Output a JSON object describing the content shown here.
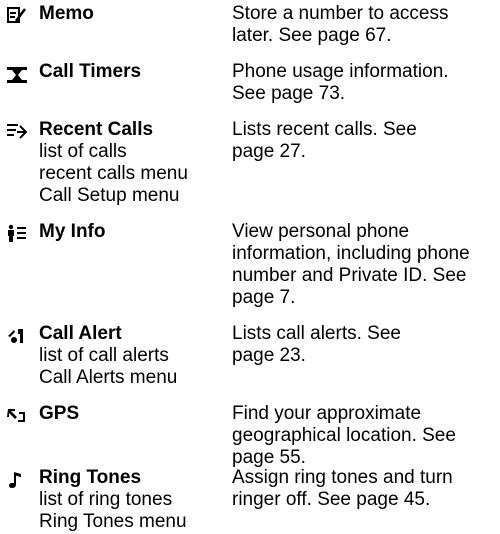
{
  "items": [
    {
      "icon": "memo-icon",
      "title": "Memo",
      "subs": [],
      "desc": [
        "Store a number to access",
        "later. See page 67."
      ]
    },
    {
      "icon": "call-timers-icon",
      "title": "Call Timers",
      "subs": [],
      "desc": [
        "Phone usage information.",
        "See page 73."
      ]
    },
    {
      "icon": "recent-calls-icon",
      "title": "Recent Calls",
      "subs": [
        "list of calls",
        "recent calls menu",
        "Call Setup menu"
      ],
      "desc": [
        "Lists recent calls. See",
        "page 27."
      ]
    },
    {
      "icon": "my-info-icon",
      "title": "My Info",
      "subs": [],
      "desc": [
        "View personal phone",
        "information, including phone",
        "number and Private ID. See",
        "page 7."
      ]
    },
    {
      "icon": "call-alert-icon",
      "title": "Call Alert",
      "subs": [
        "list of call alerts",
        "Call Alerts menu"
      ],
      "desc": [
        "Lists call alerts. See",
        "page 23."
      ]
    },
    {
      "icon": "gps-icon",
      "title": "GPS",
      "subs": [],
      "desc": [
        "Find your approximate",
        "geographical location. See",
        "page 55."
      ]
    },
    {
      "icon": "ring-tones-icon",
      "title": "Ring Tones",
      "subs": [
        "list of ring tones",
        "Ring Tones menu"
      ],
      "desc": [
        "Assign ring tones and turn",
        "ringer off. See page 45."
      ]
    }
  ]
}
